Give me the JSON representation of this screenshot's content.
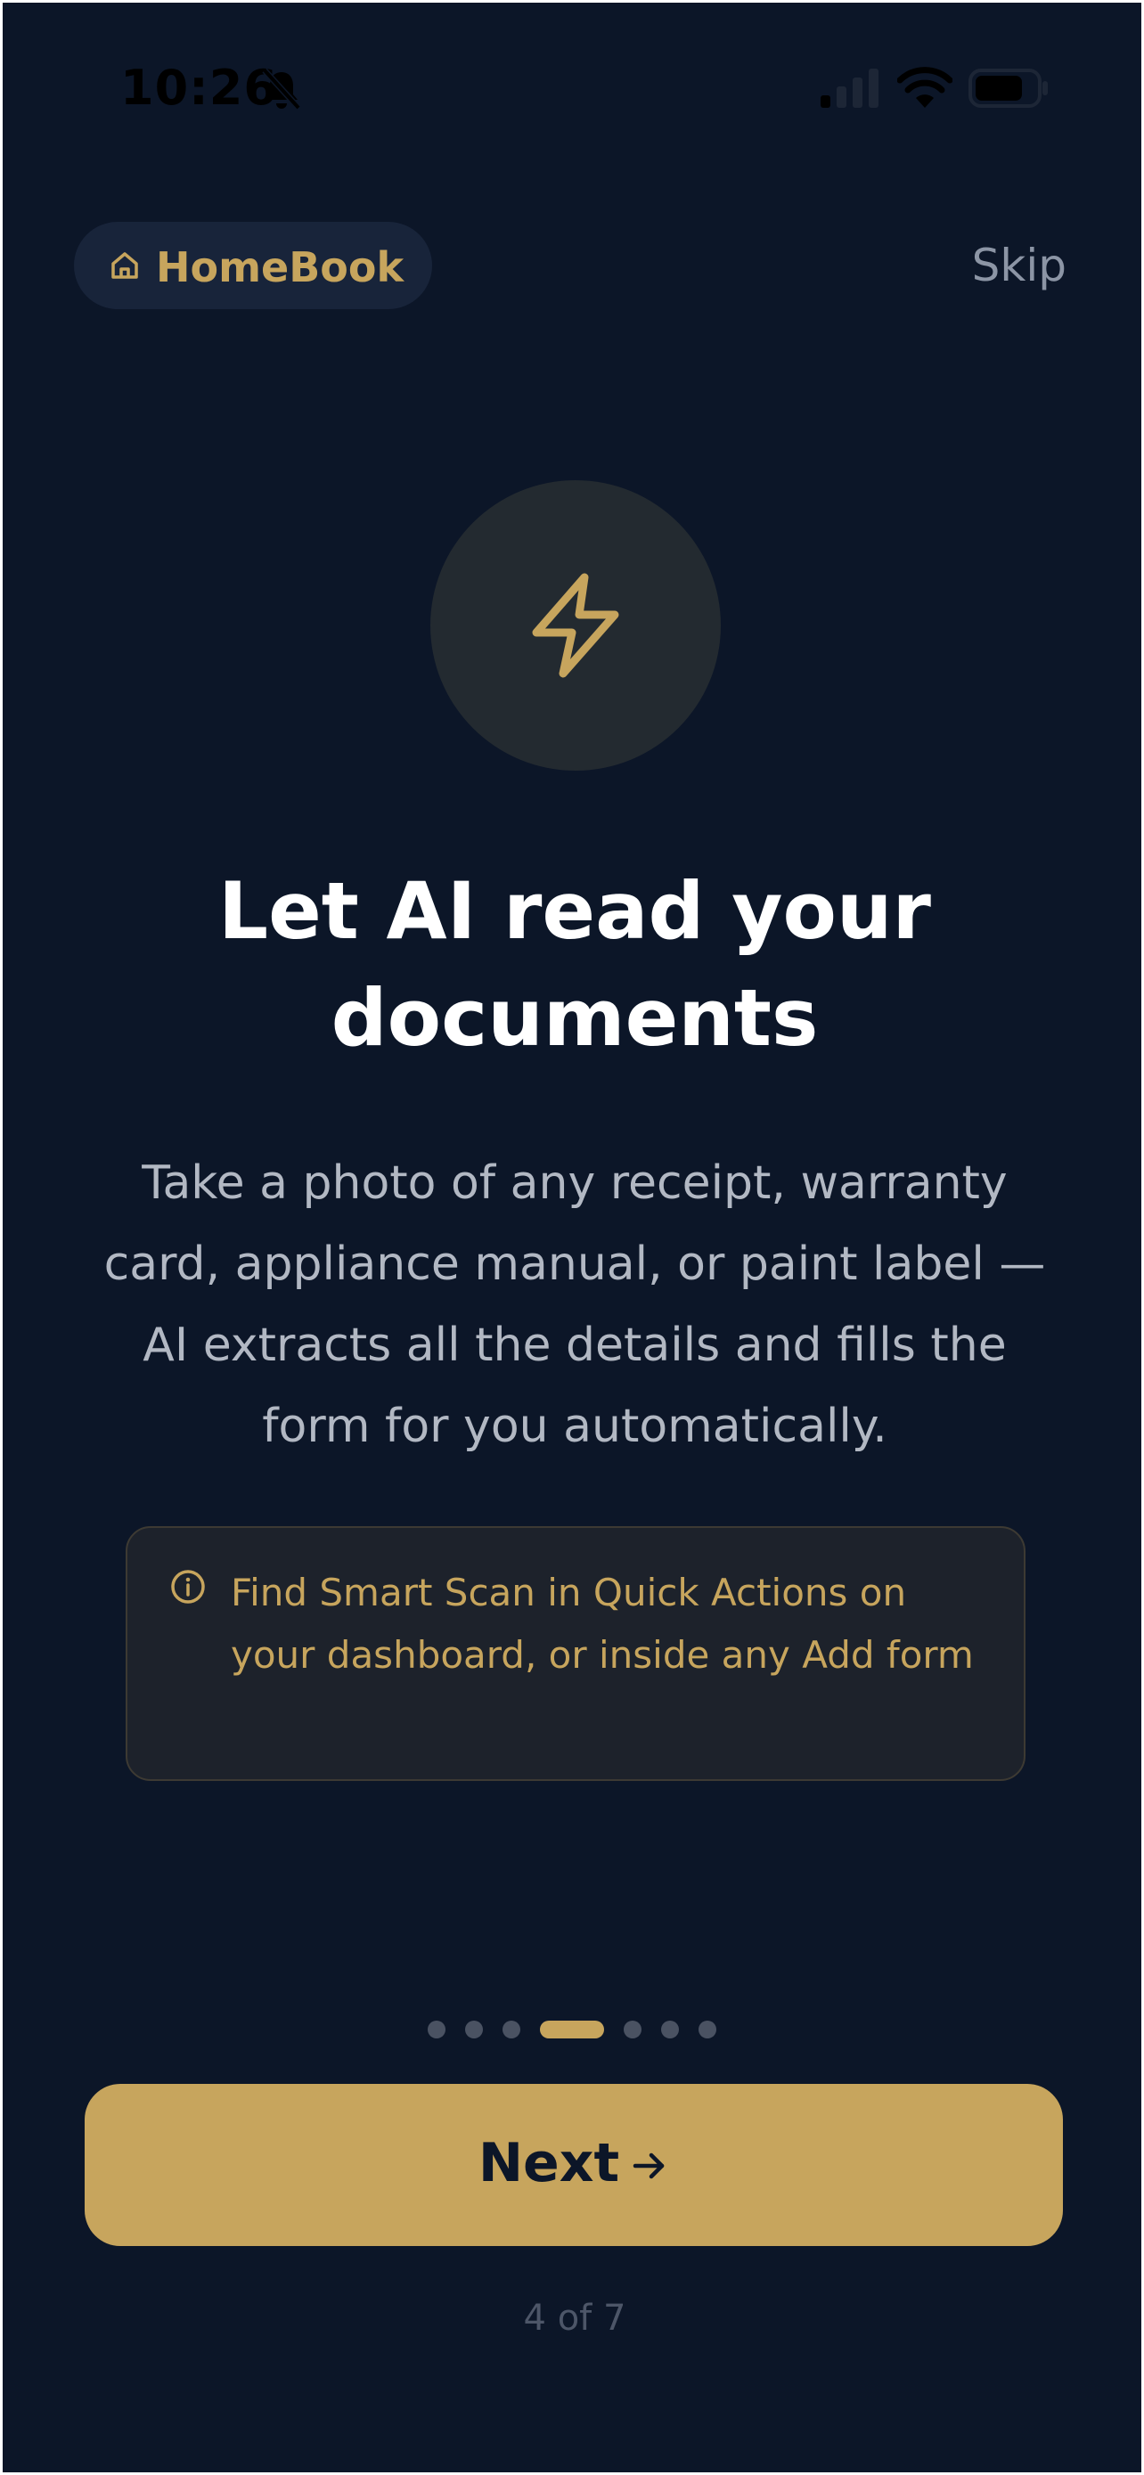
{
  "status_bar": {
    "time": "10:26",
    "icons": [
      "bell-slash-icon",
      "signal-icon",
      "wifi-icon",
      "battery-icon"
    ]
  },
  "header": {
    "brand": "HomeBook",
    "brand_icon": "home-icon",
    "skip_label": "Skip"
  },
  "hero": {
    "icon": "bolt-icon"
  },
  "content": {
    "title": "Let AI read your documents",
    "description": "Take a photo of any receipt, warranty card, appliance manual, or paint label — AI extracts all the details and fills the form for you automatically."
  },
  "info": {
    "icon": "info-icon",
    "text": "Find Smart Scan in Quick Actions on your dashboard, or inside any Add form"
  },
  "pager": {
    "total": 7,
    "current": 4
  },
  "footer": {
    "next_label": "Next",
    "next_icon": "arrow-right-icon",
    "step_text": "4 of 7"
  },
  "colors": {
    "background": "#0c1628",
    "accent": "#c7a55d",
    "title": "#ffffff",
    "body_text": "#b2b8c3",
    "muted": "#8c95a5",
    "dot_inactive": "#4a5262",
    "icon_circle": "#232a30",
    "info_box": "#1d222b"
  }
}
